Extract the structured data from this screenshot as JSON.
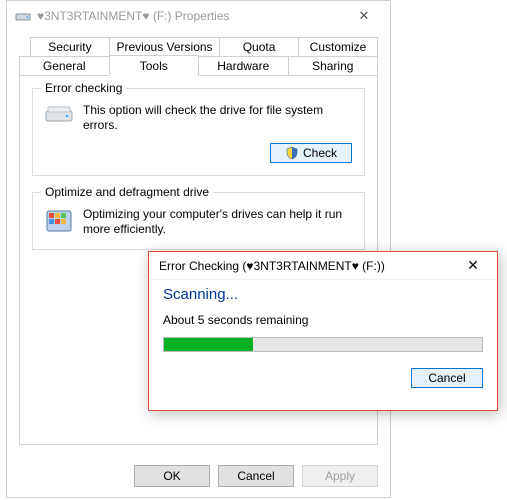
{
  "window": {
    "title": "♥3NT3RTAINMENT♥ (F:) Properties"
  },
  "tabs_row1": [
    {
      "label": "Security"
    },
    {
      "label": "Previous Versions"
    },
    {
      "label": "Quota"
    },
    {
      "label": "Customize"
    }
  ],
  "tabs_row2": [
    {
      "label": "General"
    },
    {
      "label": "Tools"
    },
    {
      "label": "Hardware"
    },
    {
      "label": "Sharing"
    }
  ],
  "errorcheck": {
    "title": "Error checking",
    "desc": "This option will check the drive for file system errors.",
    "button": "Check"
  },
  "optimize": {
    "title": "Optimize and defragment drive",
    "desc": "Optimizing your computer's drives can help it run more efficiently."
  },
  "buttons": {
    "ok": "OK",
    "cancel": "Cancel",
    "apply": "Apply"
  },
  "modal": {
    "title": "Error Checking (♥3NT3RTAINMENT♥ (F:))",
    "status": "Scanning...",
    "remaining": "About 5 seconds remaining",
    "cancel": "Cancel",
    "progress_pct": 28
  }
}
